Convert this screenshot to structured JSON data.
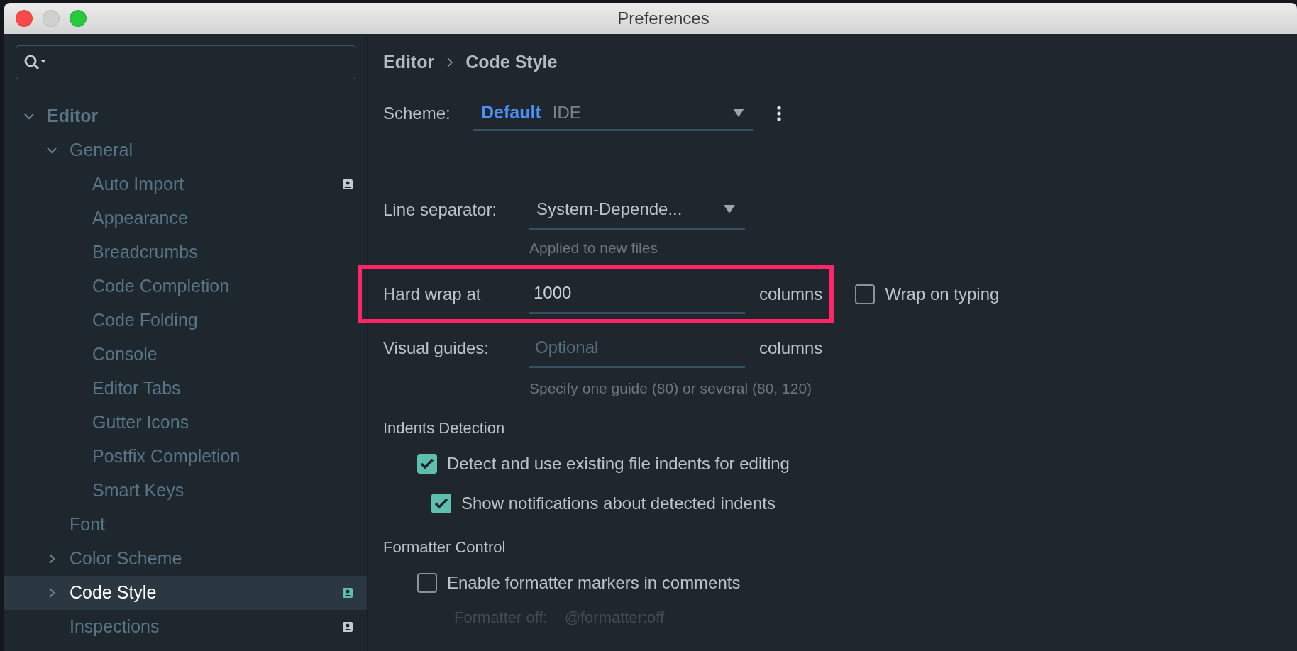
{
  "window": {
    "title": "Preferences"
  },
  "sidebar": {
    "items": [
      {
        "label": "Editor",
        "bold": true,
        "expanded": true,
        "selected": false,
        "badge": false,
        "children": [
          {
            "label": "General",
            "expanded": true,
            "selected": false,
            "badge": false,
            "children": [
              {
                "label": "Auto Import",
                "selected": false,
                "badge": true
              },
              {
                "label": "Appearance",
                "selected": false,
                "badge": false
              },
              {
                "label": "Breadcrumbs",
                "selected": false,
                "badge": false
              },
              {
                "label": "Code Completion",
                "selected": false,
                "badge": false
              },
              {
                "label": "Code Folding",
                "selected": false,
                "badge": false
              },
              {
                "label": "Console",
                "selected": false,
                "badge": false
              },
              {
                "label": "Editor Tabs",
                "selected": false,
                "badge": false
              },
              {
                "label": "Gutter Icons",
                "selected": false,
                "badge": false
              },
              {
                "label": "Postfix Completion",
                "selected": false,
                "badge": false
              },
              {
                "label": "Smart Keys",
                "selected": false,
                "badge": false
              }
            ]
          },
          {
            "label": "Font",
            "selected": false,
            "badge": false
          },
          {
            "label": "Color Scheme",
            "expanded": false,
            "selected": false,
            "badge": false
          },
          {
            "label": "Code Style",
            "expanded": false,
            "selected": true,
            "badge": true
          },
          {
            "label": "Inspections",
            "selected": false,
            "badge": true
          }
        ]
      }
    ]
  },
  "breadcrumb": [
    "Editor",
    "Code Style"
  ],
  "scheme": {
    "label": "Scheme:",
    "value": "Default",
    "qualifier": "IDE"
  },
  "line_separator": {
    "label": "Line separator:",
    "value": "System-Depende...",
    "hint": "Applied to new files"
  },
  "hard_wrap": {
    "label": "Hard wrap at",
    "value": "1000",
    "unit": "columns",
    "highlighted": true
  },
  "wrap_on_typing": {
    "label": "Wrap on typing",
    "checked": false
  },
  "visual_guides": {
    "label": "Visual guides:",
    "placeholder": "Optional",
    "unit": "columns",
    "hint": "Specify one guide (80) or several (80, 120)"
  },
  "sections": [
    {
      "title": "Indents Detection",
      "options": [
        {
          "label": "Detect and use existing file indents for editing",
          "checked": true,
          "children": [
            {
              "label": "Show notifications about detected indents",
              "checked": true
            }
          ]
        }
      ]
    },
    {
      "title": "Formatter Control",
      "options": [
        {
          "label": "Enable formatter markers in comments",
          "checked": false
        }
      ],
      "fields": [
        {
          "label": "Formatter off:",
          "value": "@formatter:off",
          "disabled": true
        }
      ]
    }
  ]
}
